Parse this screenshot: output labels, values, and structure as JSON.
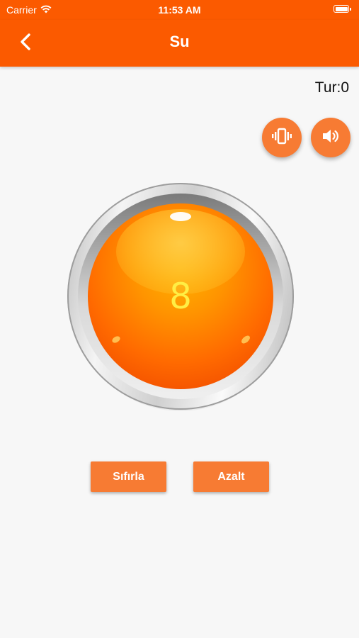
{
  "status_bar": {
    "carrier": "Carrier",
    "time": "11:53 AM",
    "wifi_icon": "wifi-icon",
    "battery_icon": "battery-icon"
  },
  "nav": {
    "title": "Su",
    "back_icon": "chevron-left-icon",
    "color": "#fb5a00"
  },
  "tur": {
    "label": "Tur:0"
  },
  "controls": {
    "vibrate_icon": "vibrate-icon",
    "sound_icon": "speaker-icon",
    "color": "#f77b33"
  },
  "counter": {
    "value": "8",
    "value_color": "#ffee44"
  },
  "buttons": {
    "reset_label": "Sıfırla",
    "decrease_label": "Azalt"
  }
}
